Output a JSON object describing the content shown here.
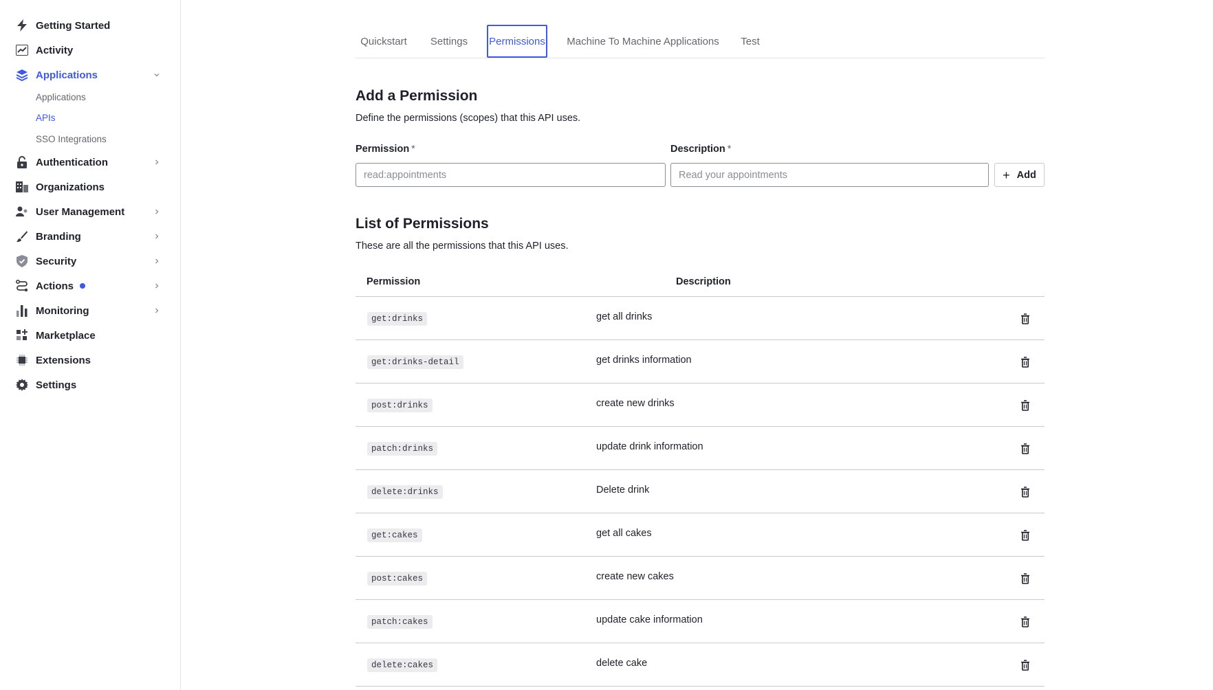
{
  "sidebar": {
    "items": [
      {
        "label": "Getting Started",
        "icon": "bolt-icon"
      },
      {
        "label": "Activity",
        "icon": "activity-chart-icon"
      },
      {
        "label": "Applications",
        "icon": "layers-icon"
      },
      {
        "label": "Authentication",
        "icon": "lock-icon"
      },
      {
        "label": "Organizations",
        "icon": "building-icon"
      },
      {
        "label": "User Management",
        "icon": "users-icon"
      },
      {
        "label": "Branding",
        "icon": "brush-icon"
      },
      {
        "label": "Security",
        "icon": "shield-icon"
      },
      {
        "label": "Actions",
        "icon": "actions-flow-icon"
      },
      {
        "label": "Monitoring",
        "icon": "bar-chart-icon"
      },
      {
        "label": "Marketplace",
        "icon": "marketplace-grid-icon"
      },
      {
        "label": "Extensions",
        "icon": "chip-icon"
      },
      {
        "label": "Settings",
        "icon": "gear-icon"
      }
    ],
    "sub_items": [
      {
        "label": "Applications"
      },
      {
        "label": "APIs"
      },
      {
        "label": "SSO Integrations"
      }
    ],
    "accent_color": "#3f59e4"
  },
  "tabs": [
    {
      "label": "Quickstart"
    },
    {
      "label": "Settings"
    },
    {
      "label": "Permissions"
    },
    {
      "label": "Machine To Machine Applications"
    },
    {
      "label": "Test"
    }
  ],
  "add_section": {
    "title": "Add a Permission",
    "description": "Define the permissions (scopes) that this API uses.",
    "permission_label": "Permission",
    "description_label": "Description",
    "required_mark": "*",
    "permission_placeholder": "read:appointments",
    "description_placeholder": "Read your appointments",
    "add_button_label": "Add"
  },
  "list_section": {
    "title": "List of Permissions",
    "description": "These are all the permissions that this API uses.",
    "columns": [
      "Permission",
      "Description"
    ],
    "rows": [
      {
        "scope": "get:drinks",
        "description": "get all drinks"
      },
      {
        "scope": "get:drinks-detail",
        "description": "get drinks information"
      },
      {
        "scope": "post:drinks",
        "description": "create new drinks"
      },
      {
        "scope": "patch:drinks",
        "description": "update drink information"
      },
      {
        "scope": "delete:drinks",
        "description": "Delete drink"
      },
      {
        "scope": "get:cakes",
        "description": "get all cakes"
      },
      {
        "scope": "post:cakes",
        "description": "create new cakes"
      },
      {
        "scope": "patch:cakes",
        "description": "update cake information"
      },
      {
        "scope": "delete:cakes",
        "description": "delete cake"
      }
    ]
  }
}
